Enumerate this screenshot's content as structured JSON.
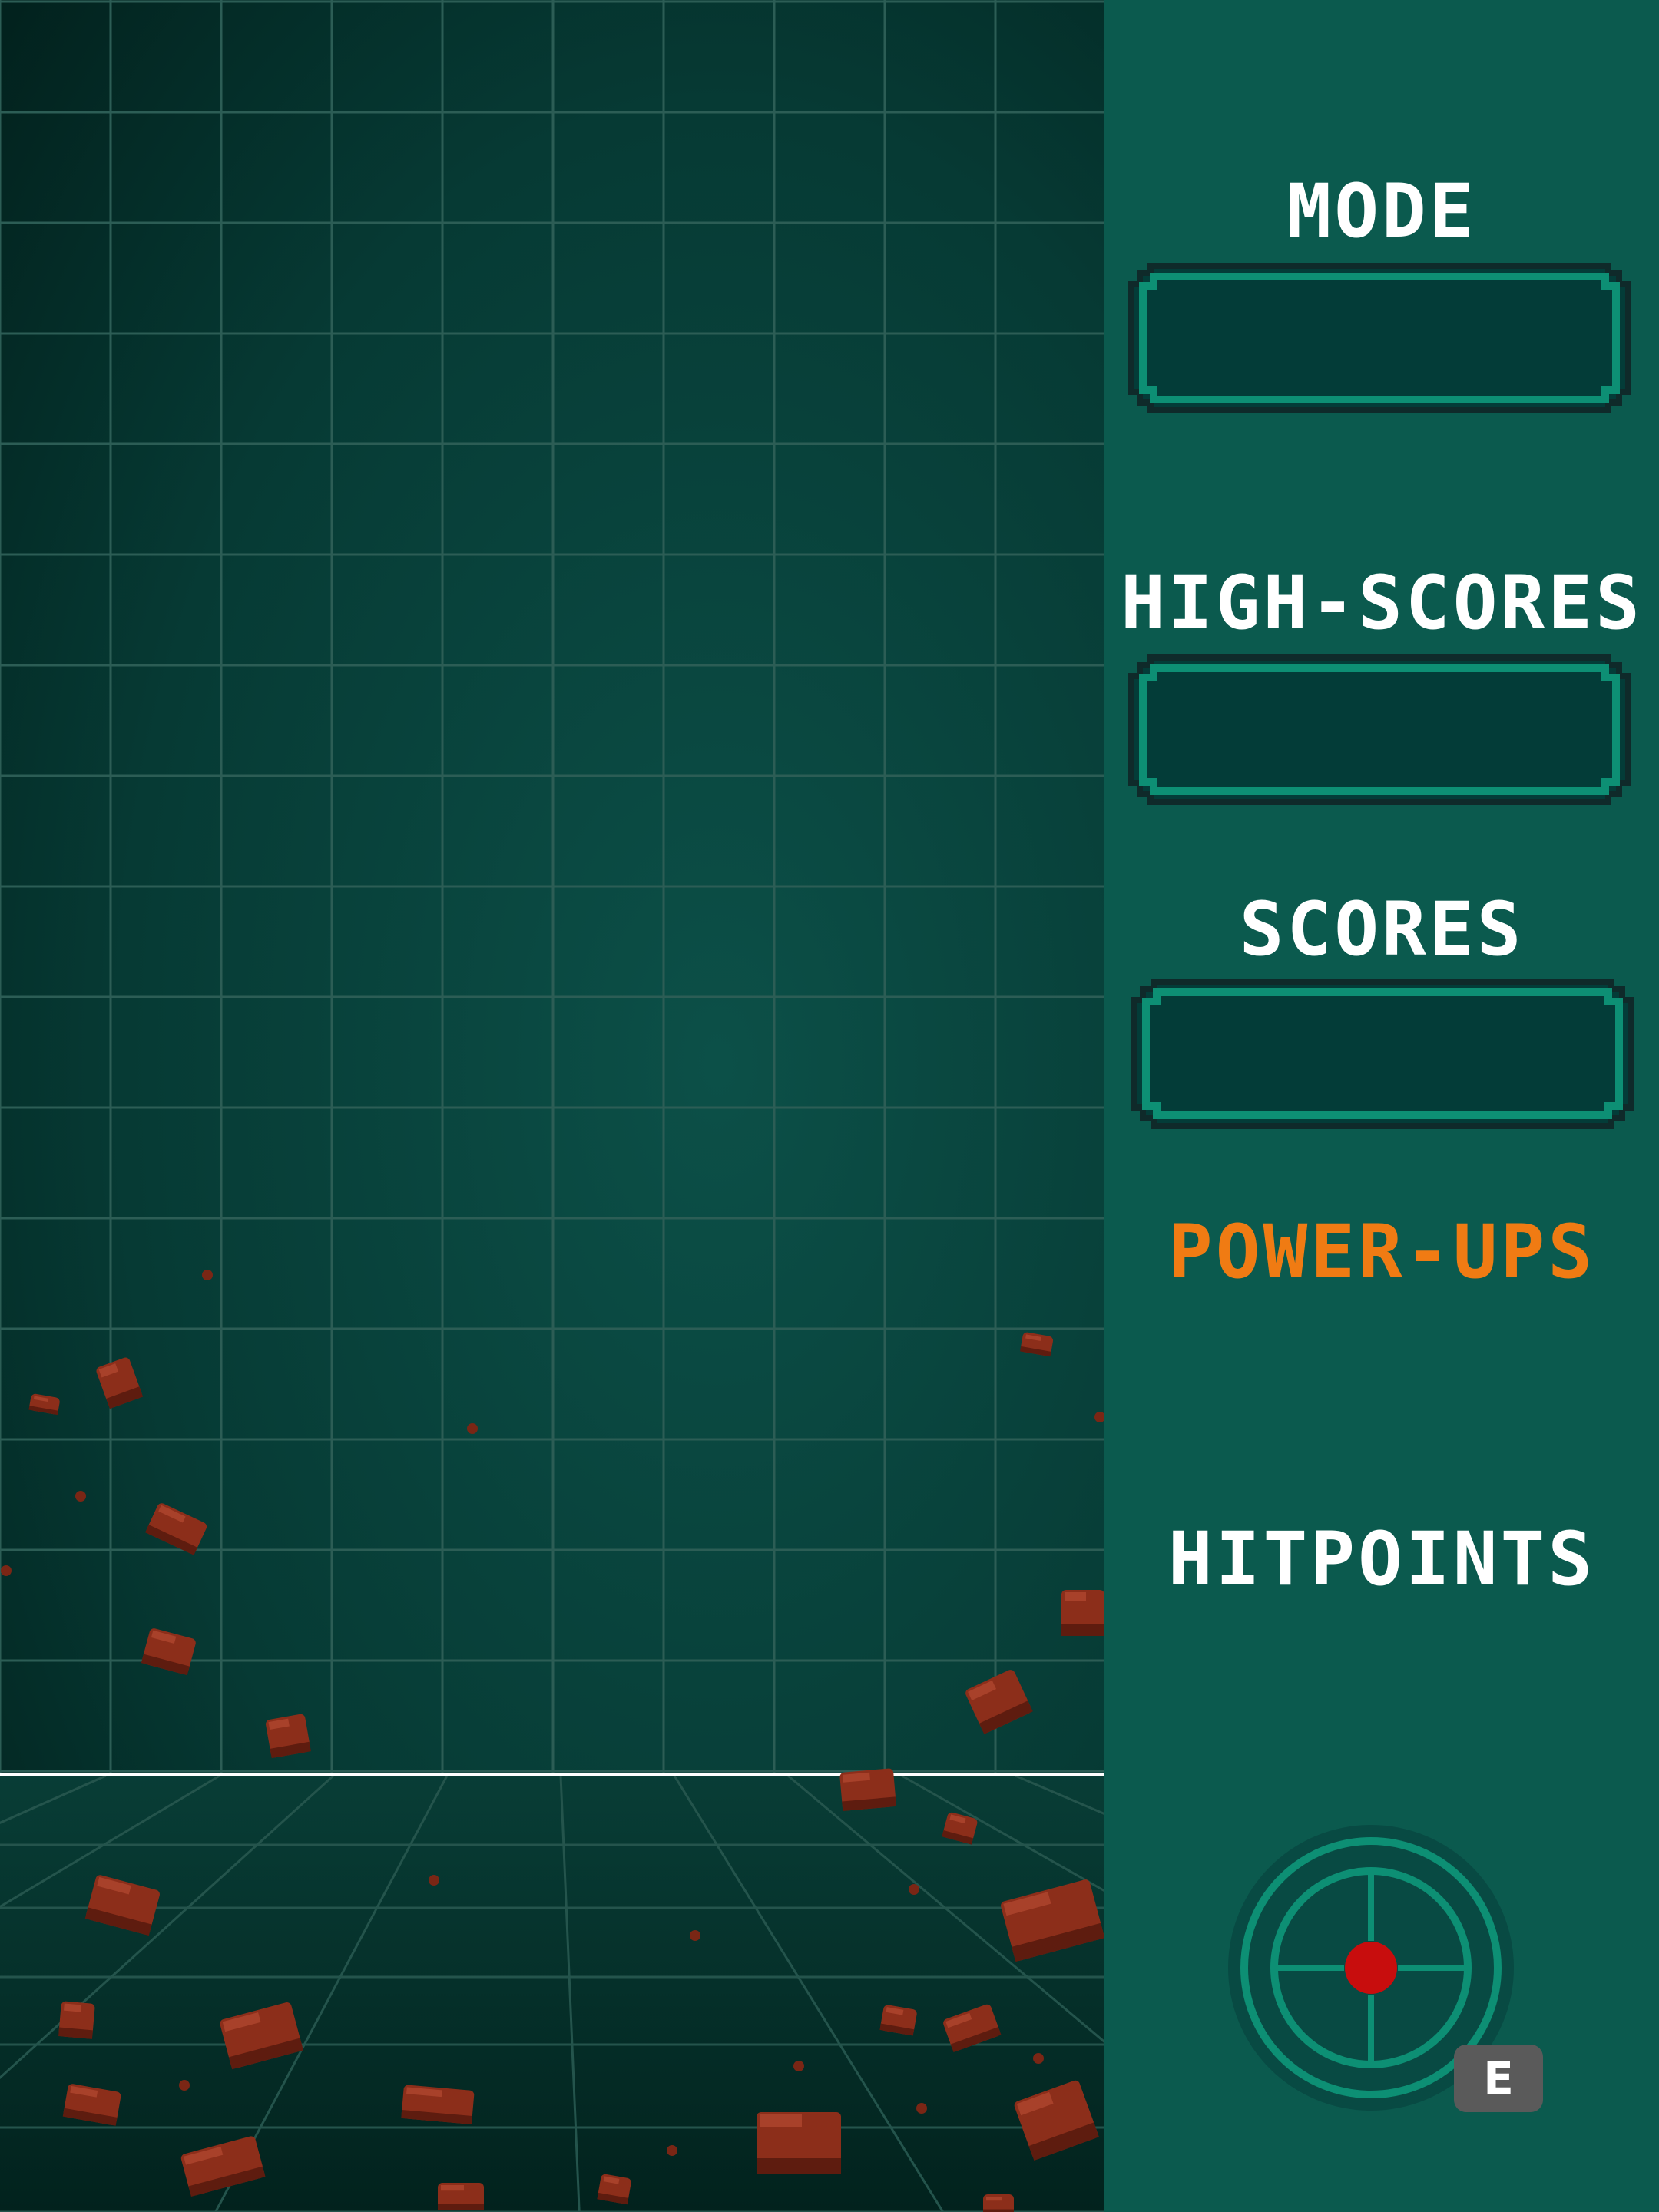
{
  "sidebar": {
    "mode_label": "MODE",
    "highscores_label": "HIGH-SCORES",
    "scores_label": "SCORES",
    "powerups_label": "POWER-UPS",
    "hitpoints_label": "HITPOINTS"
  },
  "controls": {
    "ability_key": "E"
  },
  "colors": {
    "sidebar_bg": "#0b5a4e",
    "field_dark": "#022019",
    "field_mid": "#0a4a42",
    "grid_line": "#2c5d55",
    "slot_fill": "#033c38",
    "slot_border": "#0d8f74",
    "label_text": "#ffffff",
    "powerups_text": "#f07b13",
    "rock": "#8c2e1a",
    "target_dot": "#c80d0d"
  }
}
